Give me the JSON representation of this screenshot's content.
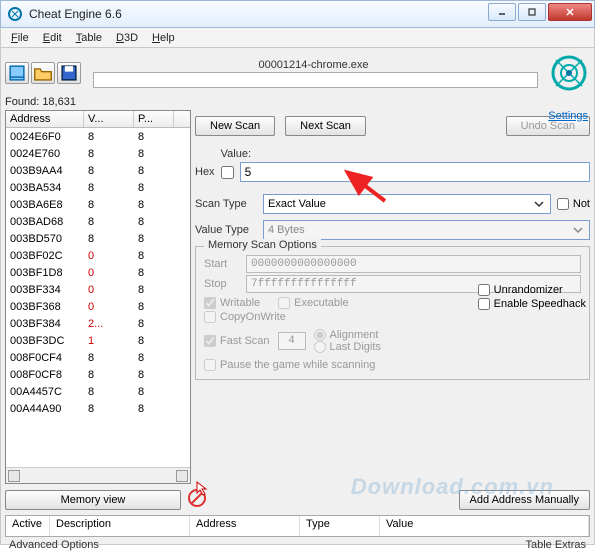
{
  "window": {
    "title": "Cheat Engine 6.6"
  },
  "menu": {
    "file": "File",
    "edit": "Edit",
    "table": "Table",
    "d3d": "D3D",
    "help": "Help"
  },
  "process": {
    "name": "00001214-chrome.exe"
  },
  "settings_label": "Settings",
  "found": {
    "label": "Found:",
    "count": "18,631"
  },
  "cols": {
    "address": "Address",
    "value": "V...",
    "prev": "P..."
  },
  "rows": [
    {
      "a": "0024E6F0",
      "v": "8",
      "p": "8",
      "c": "#000"
    },
    {
      "a": "0024E760",
      "v": "8",
      "p": "8",
      "c": "#000"
    },
    {
      "a": "003B9AA4",
      "v": "8",
      "p": "8",
      "c": "#000"
    },
    {
      "a": "003BA534",
      "v": "8",
      "p": "8",
      "c": "#000"
    },
    {
      "a": "003BA6E8",
      "v": "8",
      "p": "8",
      "c": "#000"
    },
    {
      "a": "003BAD68",
      "v": "8",
      "p": "8",
      "c": "#000"
    },
    {
      "a": "003BD570",
      "v": "8",
      "p": "8",
      "c": "#000"
    },
    {
      "a": "003BF02C",
      "v": "0",
      "p": "8",
      "c": "#c00"
    },
    {
      "a": "003BF1D8",
      "v": "0",
      "p": "8",
      "c": "#c00"
    },
    {
      "a": "003BF334",
      "v": "0",
      "p": "8",
      "c": "#c00"
    },
    {
      "a": "003BF368",
      "v": "0",
      "p": "8",
      "c": "#c00"
    },
    {
      "a": "003BF384",
      "v": "2...",
      "p": "8",
      "c": "#c00"
    },
    {
      "a": "003BF3DC",
      "v": "1",
      "p": "8",
      "c": "#c00"
    },
    {
      "a": "008F0CF4",
      "v": "8",
      "p": "8",
      "c": "#000"
    },
    {
      "a": "008F0CF8",
      "v": "8",
      "p": "8",
      "c": "#000"
    },
    {
      "a": "00A4457C",
      "v": "8",
      "p": "8",
      "c": "#000"
    },
    {
      "a": "00A44A90",
      "v": "8",
      "p": "8",
      "c": "#000"
    }
  ],
  "scan": {
    "new": "New Scan",
    "next": "Next Scan",
    "undo": "Undo Scan",
    "value_label": "Value:",
    "hex": "Hex",
    "value": "5",
    "scantype_label": "Scan Type",
    "scantype": "Exact Value",
    "not": "Not",
    "valuetype_label": "Value Type",
    "valuetype": "4 Bytes"
  },
  "memopts": {
    "legend": "Memory Scan Options",
    "start_label": "Start",
    "start": "0000000000000000",
    "stop_label": "Stop",
    "stop": "7fffffffffffffff",
    "writable": "Writable",
    "executable": "Executable",
    "copyonwrite": "CopyOnWrite",
    "fastscan": "Fast Scan",
    "fastscan_val": "4",
    "alignment": "Alignment",
    "lastdigits": "Last Digits",
    "pause": "Pause the game while scanning"
  },
  "sideopts": {
    "unrandomizer": "Unrandomizer",
    "speedhack": "Enable Speedhack"
  },
  "buttons": {
    "memview": "Memory view",
    "addmanual": "Add Address Manually"
  },
  "bottom_cols": {
    "active": "Active",
    "desc": "Description",
    "addr": "Address",
    "type": "Type",
    "value": "Value"
  },
  "footer": {
    "advopts": "Advanced Options",
    "extras": "Table Extras"
  },
  "watermark": "Download.com.vn"
}
